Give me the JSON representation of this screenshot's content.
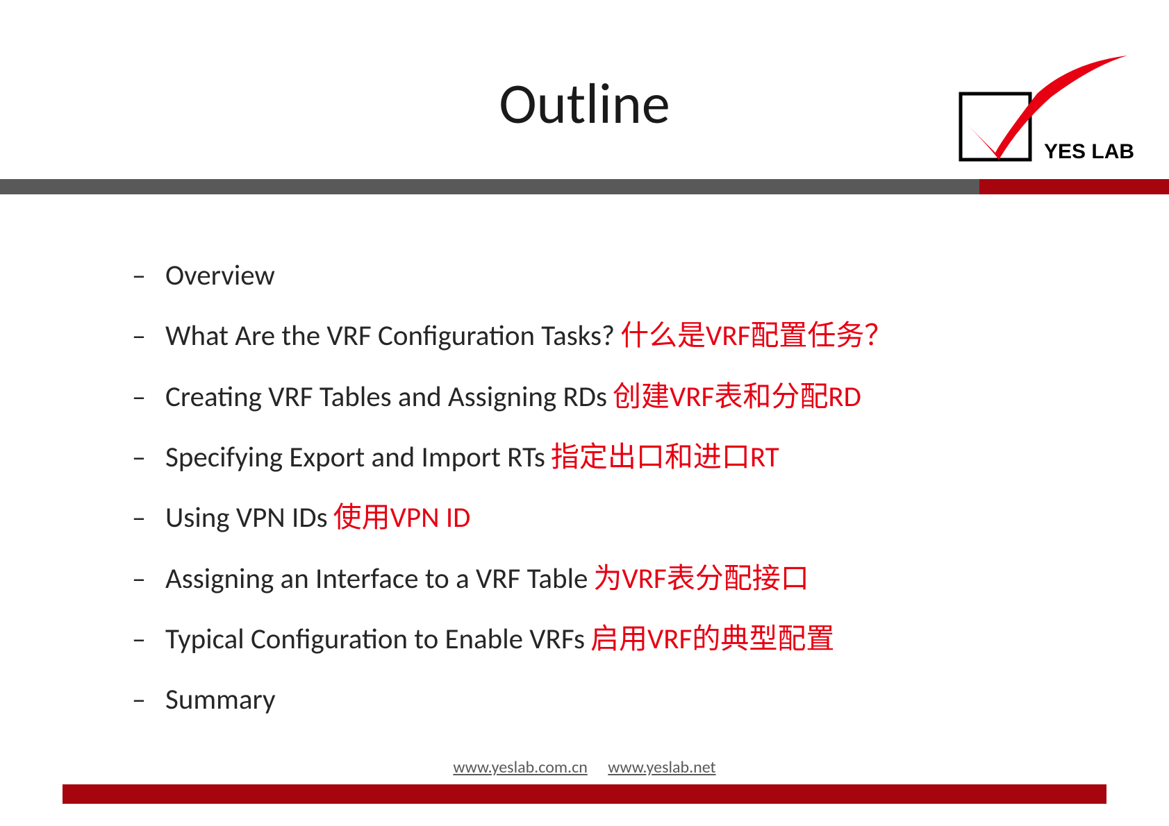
{
  "title": "Outline",
  "logo": {
    "text": "YES LAB"
  },
  "bullets": [
    {
      "en": "Overview",
      "zh": ""
    },
    {
      "en": "What Are the VRF Configuration Tasks?",
      "zh": "什么是VRF配置任务？"
    },
    {
      "en": "Creating VRF Tables and Assigning RDs",
      "zh": "创建VRF表和分配RD"
    },
    {
      "en": "Specifying Export and Import RTs",
      "zh": "指定出口和进口RT"
    },
    {
      "en": "Using VPN IDs",
      "zh": "使用VPN ID"
    },
    {
      "en": "Assigning an Interface to a VRF Table",
      "zh": "为VRF表分配接口"
    },
    {
      "en": "Typical Configuration to Enable VRFs",
      "zh": "启用VRF的典型配置"
    },
    {
      "en": "Summary",
      "zh": ""
    }
  ],
  "footer": {
    "link1": "www.yeslab.com.cn",
    "link2": "www.yeslab.net"
  }
}
